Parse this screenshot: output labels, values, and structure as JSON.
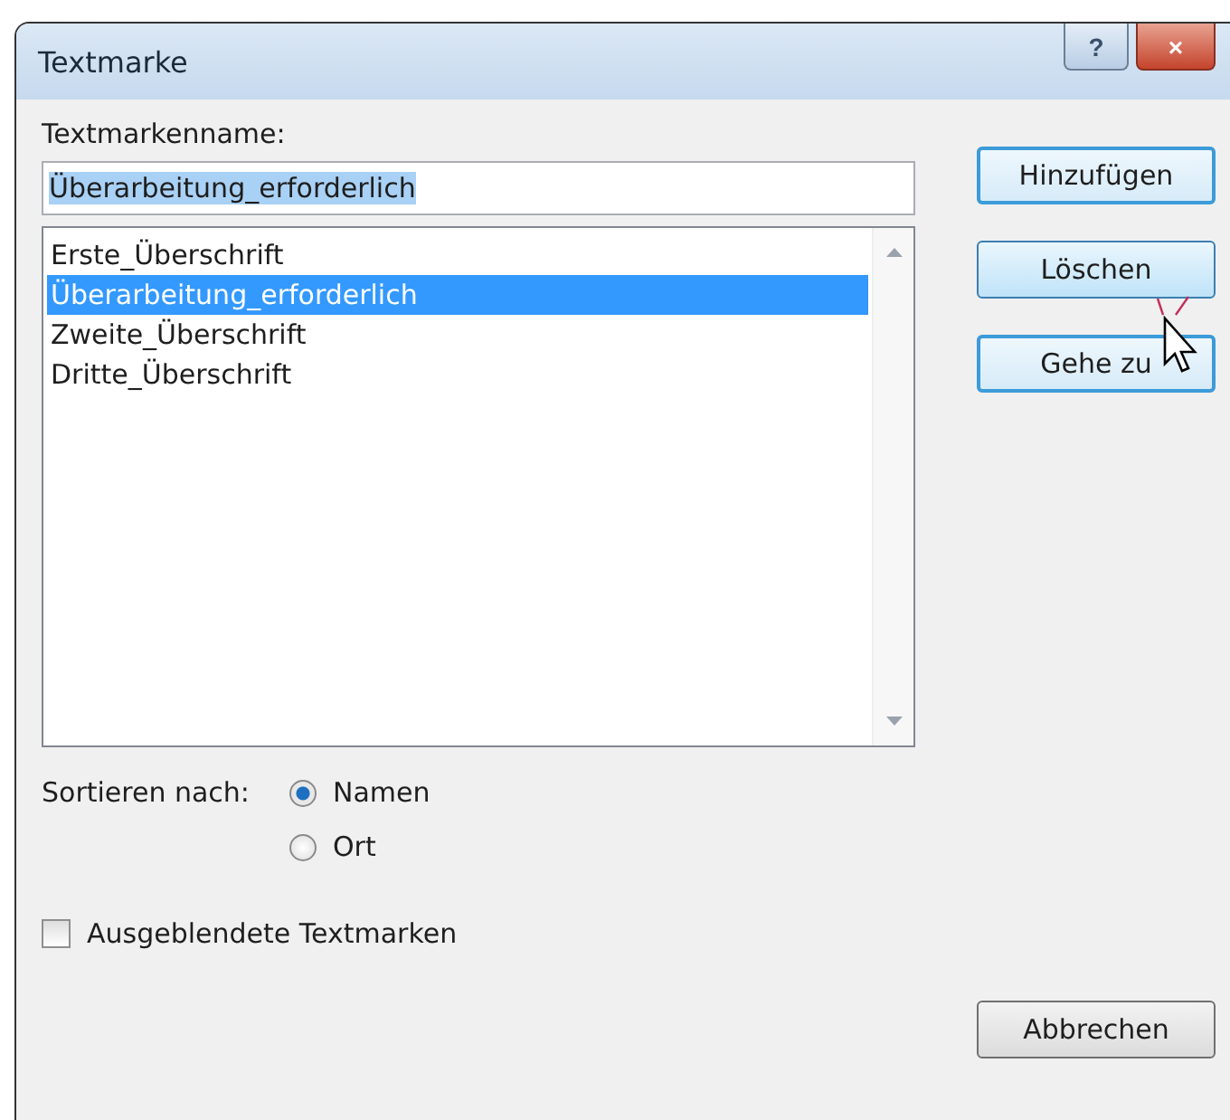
{
  "window": {
    "title": "Textmarke",
    "help_button": "?",
    "close_button": "×"
  },
  "name_field": {
    "label": "Textmarkenname:",
    "value": "Überarbeitung_erforderlich"
  },
  "bookmarks": [
    {
      "name": "Erste_Überschrift",
      "selected": false
    },
    {
      "name": "Überarbeitung_erforderlich",
      "selected": true
    },
    {
      "name": "Zweite_Überschrift",
      "selected": false
    },
    {
      "name": "Dritte_Überschrift",
      "selected": false
    }
  ],
  "buttons": [
    {
      "label": "Hinzufügen",
      "kind": "add"
    },
    {
      "label": "Löschen",
      "kind": "delete"
    },
    {
      "label": "Gehe zu",
      "kind": "goto"
    }
  ],
  "sort": {
    "label": "Sortieren nach:",
    "options": [
      {
        "label": "Namen",
        "selected": true
      },
      {
        "label": "Ort",
        "selected": false
      }
    ]
  },
  "hidden_bookmarks": {
    "label": "Ausgeblendete Textmarken",
    "checked": false
  },
  "cancel_button": "Abbrechen"
}
